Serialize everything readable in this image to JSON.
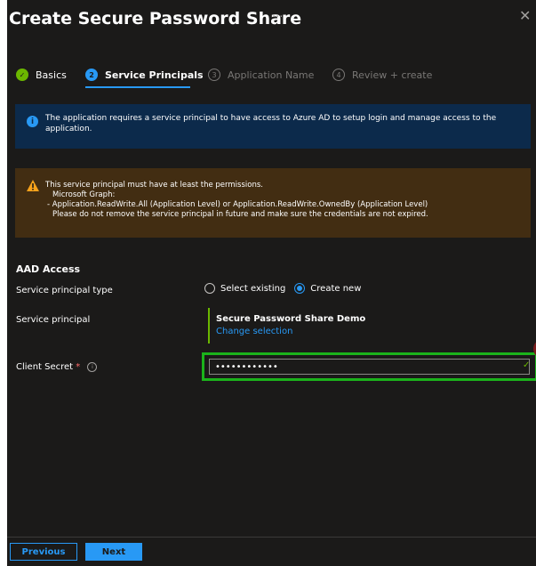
{
  "header": {
    "title": "Create Secure Password Share",
    "more": "···",
    "close": "✕"
  },
  "steps": [
    {
      "num": "✓",
      "label": "Basics",
      "state": "done"
    },
    {
      "num": "2",
      "label": "Service Principals",
      "state": "active"
    },
    {
      "num": "3",
      "label": "Application Name",
      "state": "todo"
    },
    {
      "num": "4",
      "label": "Review + create",
      "state": "todo"
    }
  ],
  "info": {
    "icon": "i",
    "text": "The application requires a service principal to have access to Azure AD to setup login and manage access to the application."
  },
  "warning": {
    "line1": "This service principal must have at least the permissions.",
    "line2": "Microsoft Graph:",
    "line3": "- Application.ReadWrite.All (Application Level) or Application.ReadWrite.OwnedBy (Application Level)",
    "line4": "Please do not remove the service principal in future and make sure the credentials are not expired."
  },
  "aad": {
    "section_title": "AAD Access",
    "sp_type_label": "Service principal type",
    "radio_existing": "Select existing",
    "radio_new": "Create new",
    "sp_label": "Service principal",
    "sp_name": "Secure Password Share Demo",
    "sp_change": "Change selection",
    "secret_label": "Client Secret",
    "secret_required": "*",
    "secret_info": "i",
    "secret_value": "••••••••••••",
    "secret_check": "✓",
    "step_badge": "2"
  },
  "footer": {
    "previous": "Previous",
    "next": "Next"
  },
  "colors": {
    "accent": "#2899f5",
    "success": "#6bb700",
    "highlight": "#1bb31b",
    "background": "#1b1a19"
  }
}
